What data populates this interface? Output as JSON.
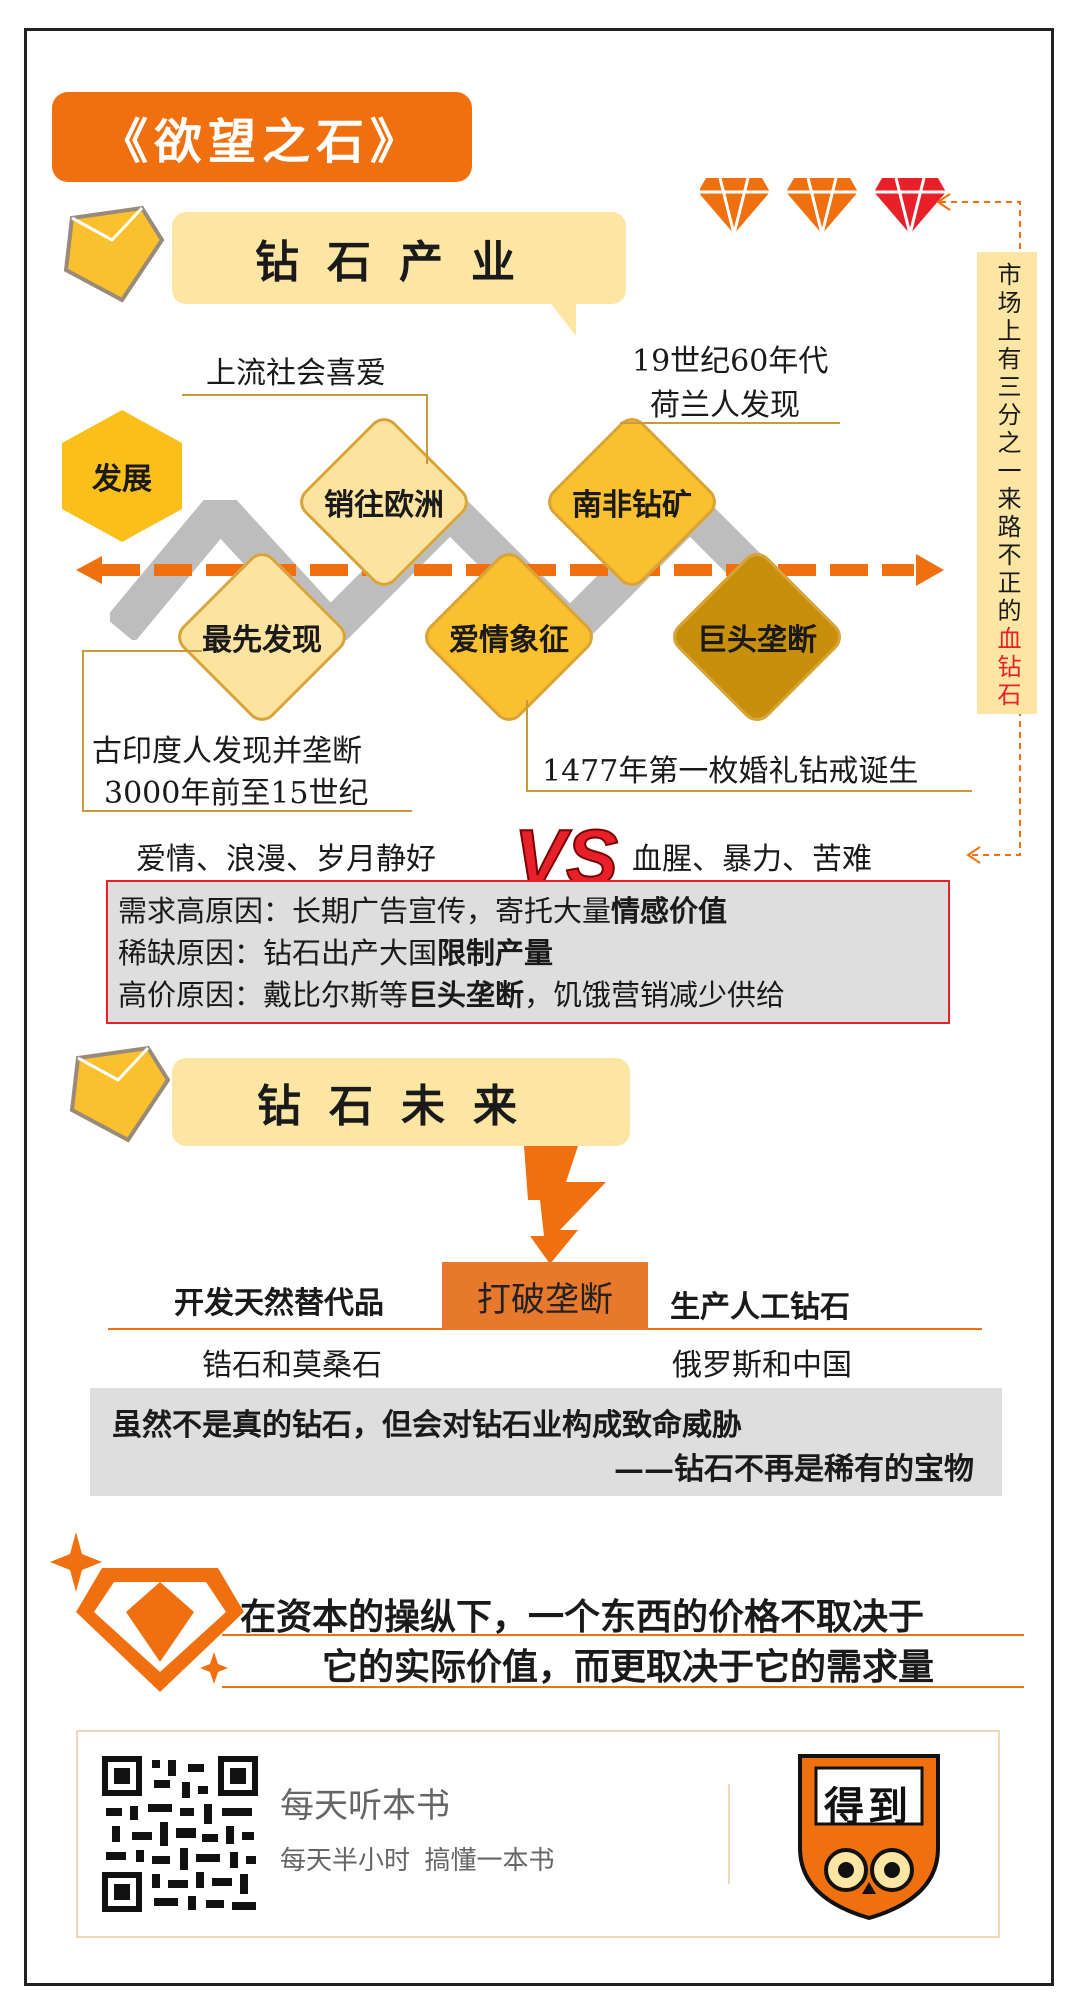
{
  "title": "《欲望之石》",
  "section1": {
    "heading": "钻石产业",
    "develop_label": "发展",
    "nodes": {
      "n1": "最先发现",
      "n2": "销往欧洲",
      "n3": "爱情象征",
      "n4": "南非钻矿",
      "n5": "巨头垄断"
    },
    "notes": {
      "europe": "上流社会喜爱",
      "south_africa_1": "19世纪60年代",
      "south_africa_2": "荷兰人发现",
      "first_1": "古印度人发现并垄断",
      "first_2": "3000年前至15世纪",
      "love": "1477年第一枚婚礼钻戒诞生"
    },
    "vertical_note_a": "市场上有三分之一来路不正的",
    "vertical_note_b": "血钻石"
  },
  "versus": {
    "left": "爱情、浪漫、岁月静好",
    "vs": "VS",
    "right": "血腥、暴力、苦难"
  },
  "reasons": [
    {
      "plain": "需求高原因：长期广告宣传，寄托大量",
      "bold": "情感价值",
      "tail": ""
    },
    {
      "plain": "稀缺原因：钻石出产大国",
      "bold": "限制产量",
      "tail": ""
    },
    {
      "plain": "高价原因：戴比尔斯等",
      "bold": "巨头垄断",
      "tail": "，饥饿营销减少供给"
    }
  ],
  "section2": {
    "heading": "钻石未来",
    "center": "打破垄断",
    "left_title": "开发天然替代品",
    "left_sub": "锆石和莫桑石",
    "right_title": "生产人工钻石",
    "right_sub": "俄罗斯和中国",
    "box_line1": "虽然不是真的钻石，但会对钻石业构成致命威胁",
    "box_line2": "——钻石不再是稀有的宝物"
  },
  "conclusion": {
    "line1": "在资本的操纵下，一个东西的价格不取决于",
    "line2": "它的实际价值，而更取决于它的需求量"
  },
  "footer": {
    "brand_title": "每天听本书",
    "brand_sub": "每天半小时  搞懂一本书",
    "logo_text": "得到"
  },
  "colors": {
    "orange": "#f07010",
    "yellow": "#fbc02d",
    "pale": "#fde6a4",
    "red": "#e8202a"
  }
}
